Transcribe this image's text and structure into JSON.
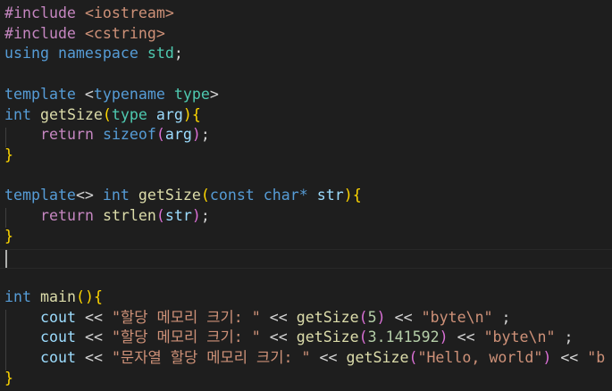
{
  "editor": {
    "language": "C++",
    "theme": {
      "background": "#1e1e1e",
      "default_text": "#d4d4d4",
      "keyword": "#569cd6",
      "control": "#c586c0",
      "preprocessor": "#c586c0",
      "include_path": "#ce9178",
      "type": "#4ec9b0",
      "function": "#dcdcaa",
      "variable": "#9cdcfe",
      "string": "#ce9178",
      "number": "#b5cea8",
      "bracket_level1": "#ffd700",
      "bracket_level2": "#da70d6",
      "bracket_level3": "#179fff"
    },
    "cursor_line": 12,
    "lines": [
      {
        "tokens": [
          {
            "t": "#include",
            "c": "preprocessor"
          },
          {
            "t": " ",
            "c": "default_text"
          },
          {
            "t": "<iostream>",
            "c": "include_path"
          }
        ]
      },
      {
        "tokens": [
          {
            "t": "#include",
            "c": "preprocessor"
          },
          {
            "t": " ",
            "c": "default_text"
          },
          {
            "t": "<cstring>",
            "c": "include_path"
          }
        ]
      },
      {
        "tokens": [
          {
            "t": "using",
            "c": "keyword"
          },
          {
            "t": " ",
            "c": "default_text"
          },
          {
            "t": "namespace",
            "c": "keyword"
          },
          {
            "t": " ",
            "c": "default_text"
          },
          {
            "t": "std",
            "c": "type"
          },
          {
            "t": ";",
            "c": "default_text"
          }
        ]
      },
      {
        "tokens": []
      },
      {
        "tokens": [
          {
            "t": "template",
            "c": "keyword"
          },
          {
            "t": " <",
            "c": "default_text"
          },
          {
            "t": "typename",
            "c": "keyword"
          },
          {
            "t": " ",
            "c": "default_text"
          },
          {
            "t": "type",
            "c": "type"
          },
          {
            "t": ">",
            "c": "default_text"
          }
        ]
      },
      {
        "tokens": [
          {
            "t": "int",
            "c": "keyword"
          },
          {
            "t": " ",
            "c": "default_text"
          },
          {
            "t": "getSize",
            "c": "function"
          },
          {
            "t": "(",
            "c": "bracket_level1"
          },
          {
            "t": "type",
            "c": "type"
          },
          {
            "t": " ",
            "c": "default_text"
          },
          {
            "t": "arg",
            "c": "variable"
          },
          {
            "t": ")",
            "c": "bracket_level1"
          },
          {
            "t": "{",
            "c": "bracket_level1"
          }
        ]
      },
      {
        "indent": 1,
        "tokens": [
          {
            "t": "return",
            "c": "control"
          },
          {
            "t": " ",
            "c": "default_text"
          },
          {
            "t": "sizeof",
            "c": "keyword"
          },
          {
            "t": "(",
            "c": "bracket_level2"
          },
          {
            "t": "arg",
            "c": "variable"
          },
          {
            "t": ")",
            "c": "bracket_level2"
          },
          {
            "t": ";",
            "c": "default_text"
          }
        ]
      },
      {
        "tokens": [
          {
            "t": "}",
            "c": "bracket_level1"
          }
        ]
      },
      {
        "tokens": []
      },
      {
        "tokens": [
          {
            "t": "template",
            "c": "keyword"
          },
          {
            "t": "<> ",
            "c": "default_text"
          },
          {
            "t": "int",
            "c": "keyword"
          },
          {
            "t": " ",
            "c": "default_text"
          },
          {
            "t": "getSize",
            "c": "function"
          },
          {
            "t": "(",
            "c": "bracket_level1"
          },
          {
            "t": "const",
            "c": "keyword"
          },
          {
            "t": " ",
            "c": "default_text"
          },
          {
            "t": "char",
            "c": "keyword"
          },
          {
            "t": "*",
            "c": "keyword"
          },
          {
            "t": " ",
            "c": "default_text"
          },
          {
            "t": "str",
            "c": "variable"
          },
          {
            "t": ")",
            "c": "bracket_level1"
          },
          {
            "t": "{",
            "c": "bracket_level1"
          }
        ]
      },
      {
        "indent": 1,
        "tokens": [
          {
            "t": "return",
            "c": "control"
          },
          {
            "t": " ",
            "c": "default_text"
          },
          {
            "t": "strlen",
            "c": "function"
          },
          {
            "t": "(",
            "c": "bracket_level2"
          },
          {
            "t": "str",
            "c": "variable"
          },
          {
            "t": ")",
            "c": "bracket_level2"
          },
          {
            "t": ";",
            "c": "default_text"
          }
        ]
      },
      {
        "tokens": [
          {
            "t": "}",
            "c": "bracket_level1"
          }
        ]
      },
      {
        "tokens": []
      },
      {
        "tokens": []
      },
      {
        "tokens": [
          {
            "t": "int",
            "c": "keyword"
          },
          {
            "t": " ",
            "c": "default_text"
          },
          {
            "t": "main",
            "c": "function"
          },
          {
            "t": "()",
            "c": "bracket_level1"
          },
          {
            "t": "{",
            "c": "bracket_level1"
          }
        ]
      },
      {
        "indent": 1,
        "tokens": [
          {
            "t": "cout",
            "c": "variable"
          },
          {
            "t": " << ",
            "c": "default_text"
          },
          {
            "t": "\"할당 메모리 크기: \"",
            "c": "string"
          },
          {
            "t": " << ",
            "c": "default_text"
          },
          {
            "t": "getSize",
            "c": "function"
          },
          {
            "t": "(",
            "c": "bracket_level2"
          },
          {
            "t": "5",
            "c": "number"
          },
          {
            "t": ")",
            "c": "bracket_level2"
          },
          {
            "t": " << ",
            "c": "default_text"
          },
          {
            "t": "\"byte\\n\"",
            "c": "string"
          },
          {
            "t": " ;",
            "c": "default_text"
          }
        ]
      },
      {
        "indent": 1,
        "tokens": [
          {
            "t": "cout",
            "c": "variable"
          },
          {
            "t": " << ",
            "c": "default_text"
          },
          {
            "t": "\"할당 메모리 크기: \"",
            "c": "string"
          },
          {
            "t": " << ",
            "c": "default_text"
          },
          {
            "t": "getSize",
            "c": "function"
          },
          {
            "t": "(",
            "c": "bracket_level2"
          },
          {
            "t": "3.141592",
            "c": "number"
          },
          {
            "t": ")",
            "c": "bracket_level2"
          },
          {
            "t": " << ",
            "c": "default_text"
          },
          {
            "t": "\"byte\\n\"",
            "c": "string"
          },
          {
            "t": " ;",
            "c": "default_text"
          }
        ]
      },
      {
        "indent": 1,
        "tokens": [
          {
            "t": "cout",
            "c": "variable"
          },
          {
            "t": " << ",
            "c": "default_text"
          },
          {
            "t": "\"문자열 할당 메모리 크기: \"",
            "c": "string"
          },
          {
            "t": " << ",
            "c": "default_text"
          },
          {
            "t": "getSize",
            "c": "function"
          },
          {
            "t": "(",
            "c": "bracket_level2"
          },
          {
            "t": "\"Hello, world\"",
            "c": "string"
          },
          {
            "t": ")",
            "c": "bracket_level2"
          },
          {
            "t": " << ",
            "c": "default_text"
          },
          {
            "t": "\"b",
            "c": "string"
          }
        ]
      },
      {
        "tokens": [
          {
            "t": "}",
            "c": "bracket_level1"
          }
        ]
      }
    ]
  }
}
